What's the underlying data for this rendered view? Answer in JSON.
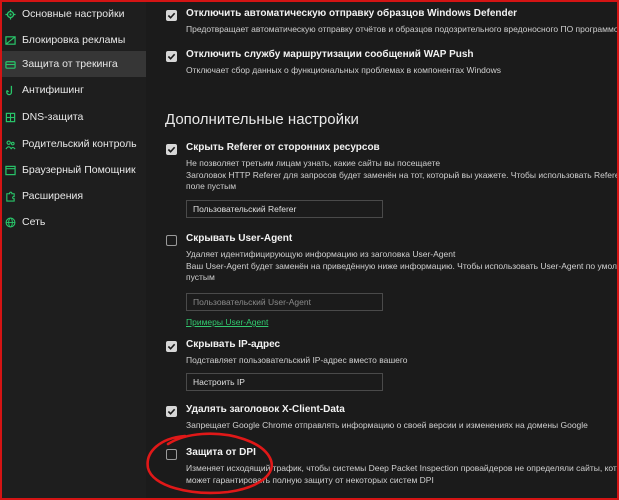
{
  "sidebar": {
    "items": [
      {
        "label": "Основные настройки",
        "icon": "gear-icon"
      },
      {
        "label": "Блокировка рекламы",
        "icon": "ad-block-icon"
      },
      {
        "label": "Защита от трекинга",
        "icon": "tracking-protection-icon"
      },
      {
        "label": "Антифишинг",
        "icon": "phishing-hook-icon"
      },
      {
        "label": "DNS-защита",
        "icon": "dns-icon"
      },
      {
        "label": "Родительский контроль",
        "icon": "parental-control-icon"
      },
      {
        "label": "Браузерный Помощник",
        "icon": "browser-assistant-icon"
      },
      {
        "label": "Расширения",
        "icon": "extensions-icon"
      },
      {
        "label": "Сеть",
        "icon": "network-globe-icon"
      }
    ],
    "active_index": 2
  },
  "options": {
    "defender": {
      "title": "Отключить автоматическую отправку образцов Windows Defender",
      "desc": "Предотвращает автоматическую отправку отчётов и образцов подозрительного вредоносного ПО программой Windows",
      "checked": true
    },
    "wap": {
      "title": "Отключить службу маршрутизации сообщений WAP Push",
      "desc": "Отключает сбор данных о функциональных проблемах в компонентах Windows",
      "checked": true
    }
  },
  "additional": {
    "section_title": "Дополнительные настройки",
    "referer": {
      "title": "Скрыть Referer от сторонних ресурсов",
      "desc": "Не позволяет третьим лицам узнать, какие сайты вы посещаете\nЗаголовок HTTP Referer для запросов будет заменён на тот, который вы укажете. Чтобы использовать Referer по умолчанию, оставьте\nполе пустым",
      "value": "Пользовательский Referer",
      "checked": true
    },
    "useragent": {
      "title": "Скрывать User-Agent",
      "desc": "Удаляет идентифицирующую информацию из заголовка User-Agent\nВаш User-Agent будет заменён на приведённую ниже информацию. Чтобы использовать User-Agent по умолчанию, оставьте поле\nпустым",
      "placeholder": "Пользовательский User-Agent",
      "link": "Примеры User-Agent",
      "checked": false
    },
    "ip": {
      "title": "Скрывать IP-адрес",
      "desc": "Подставляет пользовательский IP-адрес вместо вашего",
      "button": "Настроить IP",
      "checked": true
    },
    "xclient": {
      "title": "Удалять заголовок X-Client-Data",
      "desc": "Запрещает Google Chrome отправлять информацию о своей версии и изменениях на домены Google",
      "checked": true
    },
    "dpi": {
      "title": "Защита от DPI",
      "desc": "Изменяет исходящий трафик, чтобы системы Deep Packet Inspection провайдеров не определяли сайты, которые вы посещаете. Не\nможет гарантировать полную защиту от некоторых систем DPI",
      "checked": false
    }
  },
  "colors": {
    "accent": "#29c66a",
    "background": "#1b1b1b",
    "sidebar": "#1e1e1e",
    "annotation": "#e01818"
  }
}
